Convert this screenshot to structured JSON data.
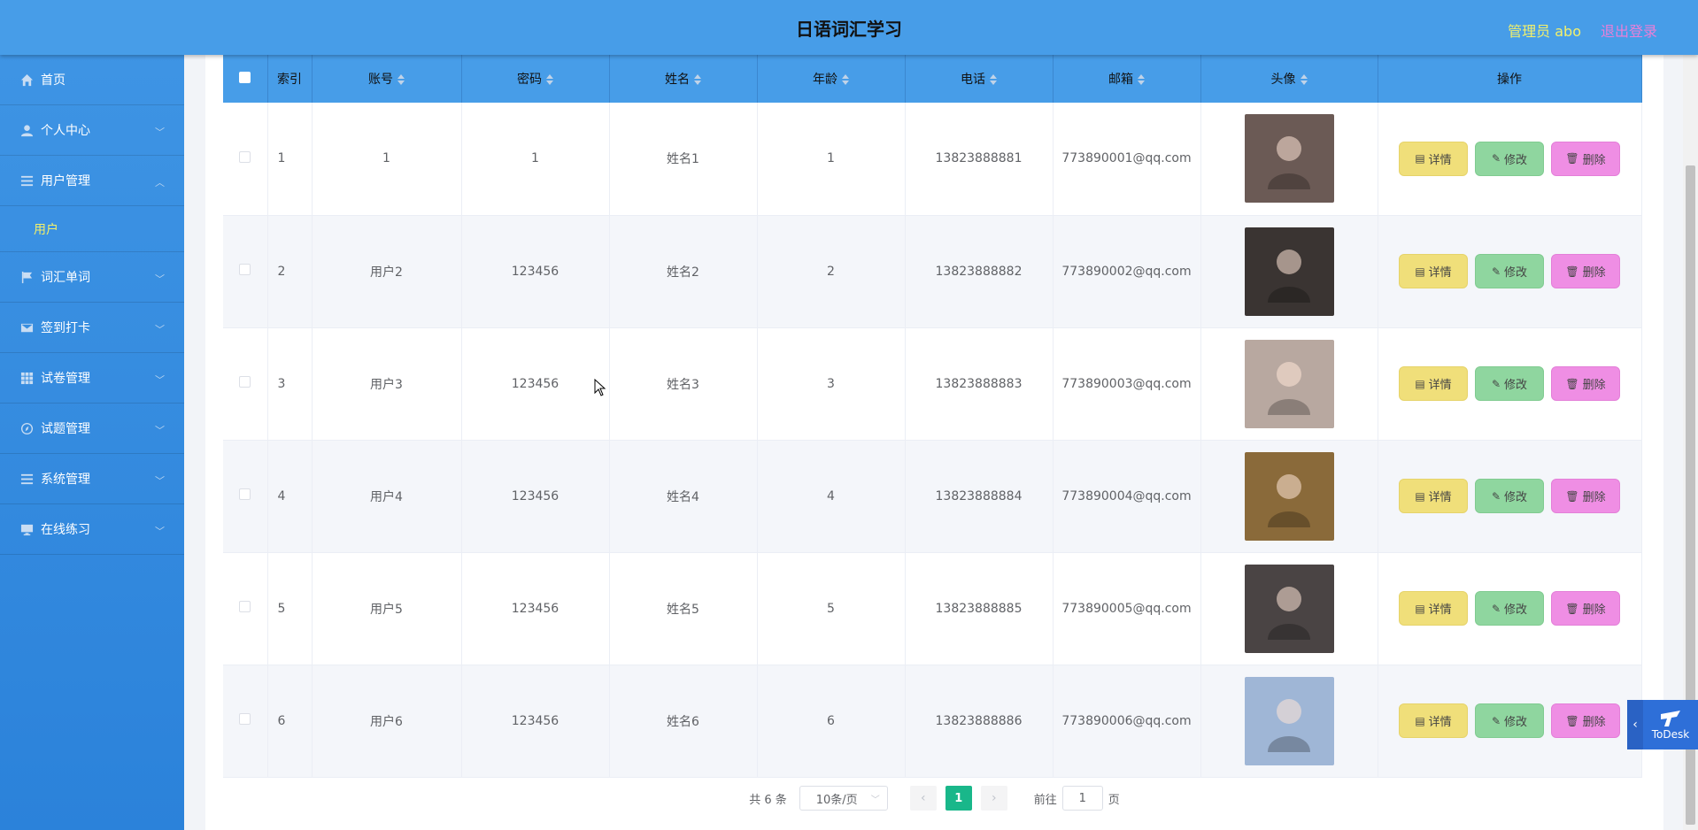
{
  "header": {
    "title": "日语词汇学习",
    "admin_label": "管理员 abo",
    "logout_label": "退出登录"
  },
  "sidebar": {
    "items": [
      {
        "label": "首页",
        "icon": "home-icon"
      },
      {
        "label": "个人中心",
        "icon": "user-icon"
      },
      {
        "label": "用户管理",
        "icon": "menu-icon",
        "expanded": true,
        "children": [
          {
            "label": "用户"
          }
        ]
      },
      {
        "label": "词汇单词",
        "icon": "flag-icon"
      },
      {
        "label": "签到打卡",
        "icon": "mail-icon"
      },
      {
        "label": "试卷管理",
        "icon": "grid-icon"
      },
      {
        "label": "试题管理",
        "icon": "compass-icon"
      },
      {
        "label": "系统管理",
        "icon": "menu-icon"
      },
      {
        "label": "在线练习",
        "icon": "monitor-icon"
      }
    ]
  },
  "table": {
    "columns": [
      "索引",
      "账号",
      "密码",
      "姓名",
      "年龄",
      "电话",
      "邮箱",
      "头像",
      "操作"
    ],
    "rows": [
      {
        "index": "1",
        "account": "1",
        "password": "1",
        "name": "姓名1",
        "age": "1",
        "phone": "13823888881",
        "email": "773890001@qq.com",
        "avatar_color": "#6b5a55"
      },
      {
        "index": "2",
        "account": "用户2",
        "password": "123456",
        "name": "姓名2",
        "age": "2",
        "phone": "13823888882",
        "email": "773890002@qq.com",
        "avatar_color": "#3a3432"
      },
      {
        "index": "3",
        "account": "用户3",
        "password": "123456",
        "name": "姓名3",
        "age": "3",
        "phone": "13823888883",
        "email": "773890003@qq.com",
        "avatar_color": "#b8a8a0"
      },
      {
        "index": "4",
        "account": "用户4",
        "password": "123456",
        "name": "姓名4",
        "age": "4",
        "phone": "13823888884",
        "email": "773890004@qq.com",
        "avatar_color": "#8a6a3a"
      },
      {
        "index": "5",
        "account": "用户5",
        "password": "123456",
        "name": "姓名5",
        "age": "5",
        "phone": "13823888885",
        "email": "773890005@qq.com",
        "avatar_color": "#4a4444"
      },
      {
        "index": "6",
        "account": "用户6",
        "password": "123456",
        "name": "姓名6",
        "age": "6",
        "phone": "13823888886",
        "email": "773890006@qq.com",
        "avatar_color": "#9fb6d6"
      }
    ],
    "actions": {
      "detail": "详情",
      "edit": "修改",
      "delete": "删除"
    }
  },
  "pagination": {
    "total": "共 6 条",
    "page_size": "10条/页",
    "current_page": "1",
    "goto_prefix": "前往",
    "goto_value": "1",
    "goto_suffix": "页"
  },
  "todesk": {
    "label": "ToDesk"
  },
  "colors": {
    "header": "#479de8",
    "sidebar": "#3e94e4",
    "active_submenu": "#f3f06b",
    "detail_button": "#f0df7a",
    "edit_button": "#8fd69f",
    "delete_button": "#ef8ee4",
    "current_page": "#19b78a"
  }
}
